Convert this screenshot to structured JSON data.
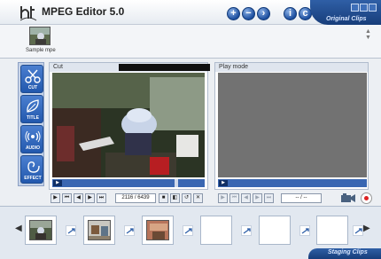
{
  "app": {
    "title": "MPEG Editor 5.0"
  },
  "header": {
    "buttons": [
      "add-icon",
      "remove-icon",
      "next-icon",
      "info-icon",
      "copyright-icon"
    ],
    "window_buttons": [
      "minimize-icon",
      "restore-icon",
      "close-icon"
    ],
    "section_label": "Original Clips"
  },
  "clip_bin": {
    "items": [
      {
        "label": "Sample mpe"
      }
    ]
  },
  "tools": [
    {
      "label": "CUT",
      "icon": "scissors-icon"
    },
    {
      "label": "TITLE",
      "icon": "leaf-icon"
    },
    {
      "label": "AUDIO",
      "icon": "audio-icon"
    },
    {
      "label": "EFFECT",
      "icon": "swirl-icon"
    }
  ],
  "cut_panel": {
    "title": "Cut",
    "seek_position": 0.82
  },
  "play_panel": {
    "title": "Play mode"
  },
  "transport": {
    "frame_counter": "2116 / 6439",
    "time_counter": "-- / --"
  },
  "storyboard": {
    "filled_slots": 3,
    "empty_slots": 3,
    "label": "Staging Clips"
  },
  "colors": {
    "accent": "#1d4f9f",
    "record": "#dd2222"
  }
}
